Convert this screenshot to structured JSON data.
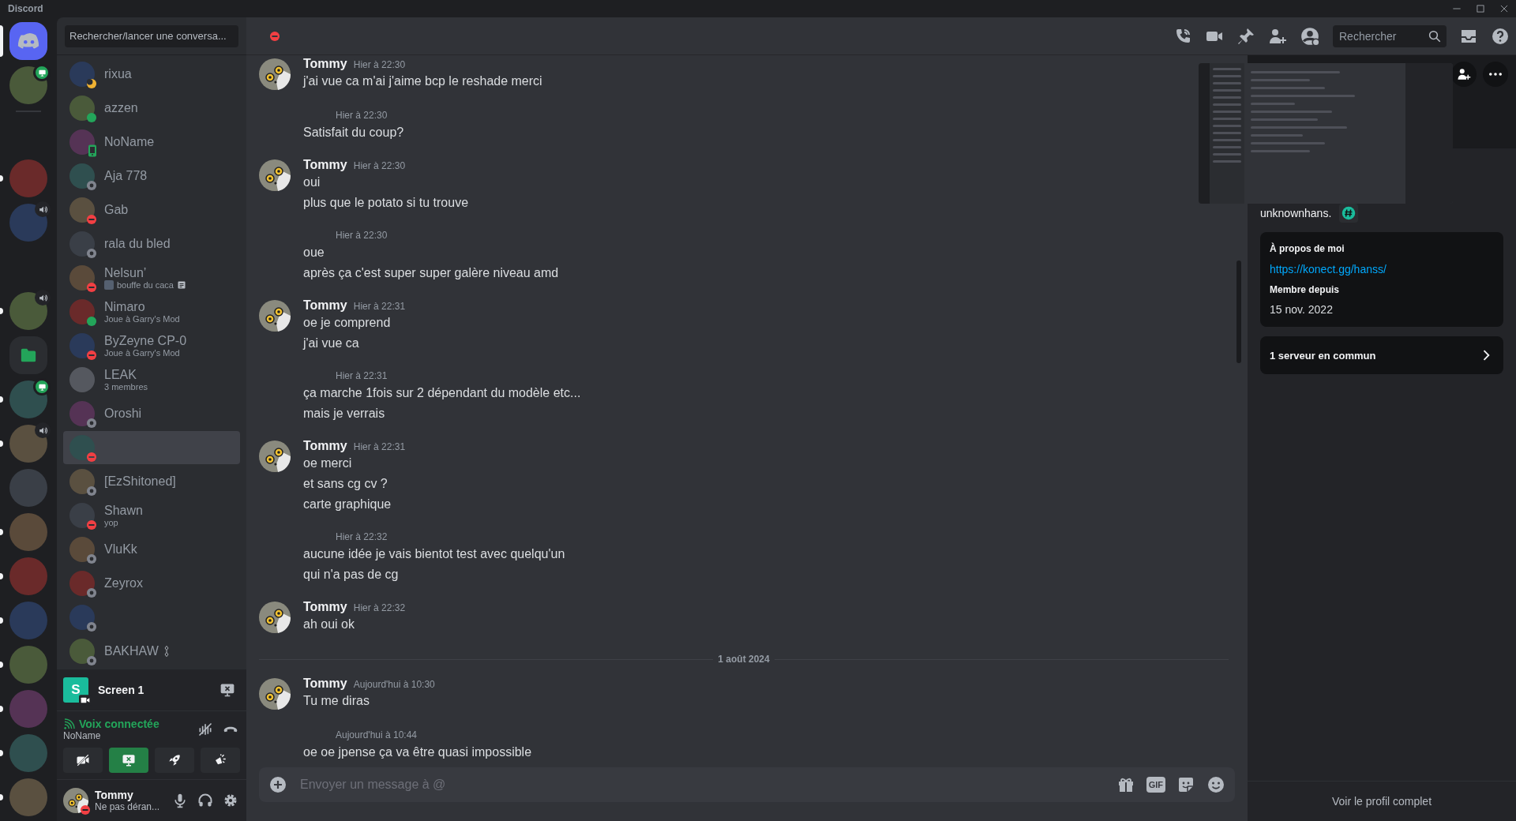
{
  "window": {
    "title": "Discord"
  },
  "servers": [
    {
      "kind": "home",
      "speaker": false,
      "screen": false,
      "selected": true
    },
    {
      "kind": "avatar",
      "speaker": false,
      "screen": true,
      "unread": false,
      "selected": false
    },
    {
      "kind": "server",
      "speaker": false,
      "screen": false,
      "unread": true,
      "selected": false
    },
    {
      "kind": "server",
      "speaker": true,
      "screen": false,
      "unread": false,
      "selected": false
    },
    {
      "kind": "server",
      "speaker": true,
      "screen": false,
      "unread": true,
      "selected": false
    },
    {
      "kind": "folder",
      "speaker": false,
      "screen": false,
      "unread": false,
      "selected": false
    },
    {
      "kind": "server",
      "speaker": false,
      "screen": true,
      "unread": true,
      "selected": false
    },
    {
      "kind": "server",
      "speaker": true,
      "screen": false,
      "unread": true,
      "selected": false
    },
    {
      "kind": "server",
      "speaker": false,
      "screen": false,
      "unread": false,
      "selected": false
    },
    {
      "kind": "server",
      "speaker": false,
      "screen": false,
      "unread": true,
      "selected": false
    },
    {
      "kind": "server",
      "speaker": false,
      "screen": false,
      "unread": true,
      "selected": false
    },
    {
      "kind": "server",
      "speaker": false,
      "screen": false,
      "unread": true,
      "selected": false
    },
    {
      "kind": "server",
      "speaker": false,
      "screen": false,
      "unread": true,
      "selected": false
    },
    {
      "kind": "server",
      "speaker": false,
      "screen": false,
      "unread": true,
      "selected": false
    },
    {
      "kind": "server",
      "speaker": false,
      "screen": false,
      "unread": true,
      "selected": false
    },
    {
      "kind": "server",
      "speaker": false,
      "screen": false,
      "unread": true,
      "selected": false
    }
  ],
  "dm_search": {
    "placeholder": "Rechercher/lancer une conversa..."
  },
  "conversations": [
    {
      "name": "rixua",
      "kind": "idle",
      "custom_status": false,
      "selected": false
    },
    {
      "name": "azzen",
      "kind": "online",
      "custom_status": false,
      "selected": false
    },
    {
      "name": "NoName",
      "kind": "mobile",
      "custom_status": false,
      "selected": false
    },
    {
      "name": "Aja 778",
      "kind": "offline",
      "custom_status": false,
      "selected": false
    },
    {
      "name": "Gab",
      "kind": "dnd",
      "custom_status": false,
      "selected": false
    },
    {
      "name": "rala du bled",
      "kind": "offline",
      "custom_status": false,
      "selected": false
    },
    {
      "name": "Nelsun’",
      "subtitle": "bouffe du caca",
      "custom_status": true,
      "kind": "dnd",
      "selected": false
    },
    {
      "name": "Nimaro",
      "subtitle": "Joue à Garry's Mod",
      "custom_status": false,
      "kind": "online",
      "selected": false
    },
    {
      "name": "ByZeyne CP-0",
      "subtitle": "Joue à Garry's Mod",
      "custom_status": false,
      "kind": "dnd",
      "selected": false
    },
    {
      "name": "LEAK",
      "subtitle": "3 membres",
      "custom_status": false,
      "kind": "group",
      "selected": false
    },
    {
      "name": "Oroshi",
      "kind": "offline",
      "custom_status": false,
      "selected": false
    },
    {
      "kind": "dnd",
      "custom_status": false,
      "selected": true
    },
    {
      "name": "[EzShitoned]",
      "kind": "offline",
      "custom_status": false,
      "selected": false
    },
    {
      "name": "Shawn",
      "subtitle": "yop",
      "custom_status": false,
      "kind": "dnd",
      "selected": false
    },
    {
      "name": "VluKk",
      "kind": "offline",
      "custom_status": false,
      "selected": false
    },
    {
      "name": "Zeyrox",
      "kind": "offline",
      "custom_status": false,
      "selected": false
    },
    {
      "kind": "offline",
      "custom_status": false,
      "selected": false
    },
    {
      "name": "BAKHAW",
      "kind": "offline",
      "custom_status": false,
      "selected": false
    }
  ],
  "stream": {
    "title": "Screen 1",
    "thumbnail_text": "S"
  },
  "voice": {
    "status": "Voix connectée",
    "channel": "NoName",
    "buttons": [
      {
        "kind": "camera",
        "active": false
      },
      {
        "kind": "screen",
        "active": true
      },
      {
        "kind": "activity",
        "active": false
      },
      {
        "kind": "soundboard",
        "active": false
      }
    ]
  },
  "user": {
    "name": "Tommy",
    "status_text": "Ne pas déran...",
    "kind": "dnd"
  },
  "header": {
    "kind": "dnd",
    "search_placeholder": "Rechercher"
  },
  "messages": [
    {
      "kind": "group",
      "author": "Tommy",
      "time": "Hier à 22:30",
      "lines": [
        "j'ai vue ca m'ai j'aime bcp le reshade merci"
      ]
    },
    {
      "kind": "followup",
      "time": "Hier à 22:30",
      "lines": [
        "Satisfait du coup?"
      ]
    },
    {
      "kind": "group",
      "author": "Tommy",
      "time": "Hier à 22:30",
      "lines": [
        "oui",
        "plus que le potato si tu trouve"
      ]
    },
    {
      "kind": "followup",
      "time": "Hier à 22:30",
      "lines": [
        "oue",
        "après ça c'est super super galère niveau amd"
      ]
    },
    {
      "kind": "group",
      "author": "Tommy",
      "time": "Hier à 22:31",
      "lines": [
        "oe je comprend",
        "j'ai vue ca"
      ]
    },
    {
      "kind": "followup",
      "time": "Hier à 22:31",
      "lines": [
        "ça marche 1fois sur 2 dépendant du modèle etc...",
        "mais je verrais"
      ]
    },
    {
      "kind": "group",
      "author": "Tommy",
      "time": "Hier à 22:31",
      "lines": [
        "oe merci",
        "et sans cg cv ?",
        "carte graphique"
      ]
    },
    {
      "kind": "followup",
      "time": "Hier à 22:32",
      "lines": [
        "aucune idée je vais bientot test avec quelqu'un",
        "qui n'a pas de cg"
      ]
    },
    {
      "kind": "group",
      "author": "Tommy",
      "time": "Hier à 22:32",
      "lines": [
        "ah oui ok"
      ]
    },
    {
      "kind": "divider",
      "label": "1 août 2024"
    },
    {
      "kind": "group",
      "author": "Tommy",
      "time": "Aujourd'hui à 10:30",
      "lines": [
        "Tu me diras"
      ]
    },
    {
      "kind": "followup",
      "time": "Aujourd'hui à 10:44",
      "lines": [
        "oe oe jpense ça va être quasi impossible"
      ]
    }
  ],
  "composer": {
    "placeholder": "Envoyer un message à @",
    "gif_label": "GIF"
  },
  "profile": {
    "username": "unknownhans.",
    "about_title": "À propos de moi",
    "link": "https://konect.gg/hanss/",
    "member_since_title": "Membre depuis",
    "member_since": "15 nov. 2022",
    "mutual_servers": "1 serveur en commun",
    "full_profile": "Voir le profil complet"
  }
}
